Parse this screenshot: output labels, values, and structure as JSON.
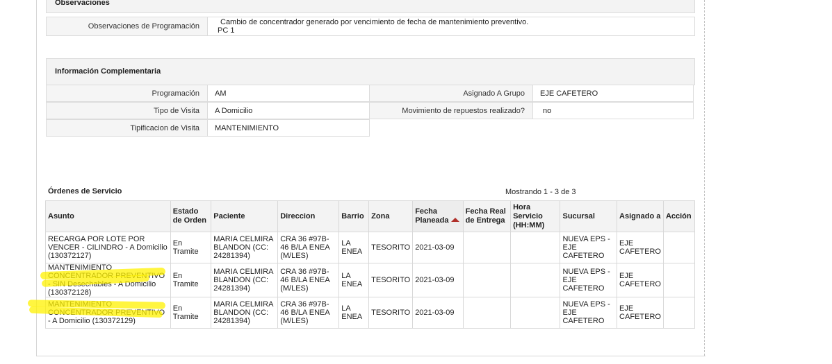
{
  "observaciones": {
    "header": "Observaciones",
    "label": "Observaciones de Programación",
    "value_line1": "Cambio de concentrador generado por vencimiento de fecha de mantenimiento preventivo.",
    "value_line2": "PC 1"
  },
  "info": {
    "header": "Información Complementaria",
    "programacion_label": "Programación",
    "programacion_value": "AM",
    "grupo_label": "Asignado A Grupo",
    "grupo_value": "EJE CAFETERO",
    "tipo_label": "Tipo de Visita",
    "tipo_value": "A Domicilio",
    "repuestos_label": "Movimiento de repuestos realizado?",
    "repuestos_value": "no",
    "tipificacion_label": "Tipificacion de Visita",
    "tipificacion_value": "MANTENIMIENTO"
  },
  "ordenes": {
    "title": "Órdenes de Servicio",
    "count": "Mostrando 1 - 3 de 3",
    "columns": [
      "Asunto",
      "Estado de Orden",
      "Paciente",
      "Direccion",
      "Barrio",
      "Zona",
      "Fecha Planeada",
      "Fecha Real de Entrega",
      "Hora Servicio (HH:MM)",
      "Sucursal",
      "Asignado a",
      "Acción"
    ],
    "rows": [
      {
        "asunto": "RECARGA POR LOTE POR VENCER - CILINDRO - A Domicilio (130372127)",
        "estado": "En Tramite",
        "paciente": "MARIA CELMIRA BLANDON (CC: 24281394)",
        "direccion": "CRA 36 #97B-46 B/LA ENEA (M/LES)",
        "barrio": "LA ENEA",
        "zona": "TESORITO",
        "fecha": "2021-03-09",
        "fecha_real": "",
        "hora": "",
        "sucursal": "NUEVA EPS - EJE CAFETERO",
        "asignado": "EJE CAFETERO",
        "accion": ""
      },
      {
        "asunto": "MANTENIMIENTO CONCENTRADOR PREVENTIVO - SIN Desechables - A Domicilio (130372128)",
        "estado": "En Tramite",
        "paciente": "MARIA CELMIRA BLANDON (CC: 24281394)",
        "direccion": "CRA 36 #97B-46 B/LA ENEA (M/LES)",
        "barrio": "LA ENEA",
        "zona": "TESORITO",
        "fecha": "2021-03-09",
        "fecha_real": "",
        "hora": "",
        "sucursal": "NUEVA EPS - EJE CAFETERO",
        "asignado": "EJE CAFETERO",
        "accion": ""
      },
      {
        "asunto": "MANTENIMIENTO CONCENTRADOR PREVENTIVO - A Domicilio (130372129)",
        "estado": "En Tramite",
        "paciente": "MARIA CELMIRA BLANDON (CC: 24281394)",
        "direccion": "CRA 36 #97B-46 B/LA ENEA (M/LES)",
        "barrio": "LA ENEA",
        "zona": "TESORITO",
        "fecha": "2021-03-09",
        "fecha_real": "",
        "hora": "",
        "sucursal": "NUEVA EPS - EJE CAFETERO",
        "asignado": "EJE CAFETERO",
        "accion": ""
      }
    ]
  },
  "colors": {
    "highlight": "#fff200",
    "sort_arrow": "#b0302a"
  },
  "icons": {
    "sort": "sort-ascending-icon"
  }
}
